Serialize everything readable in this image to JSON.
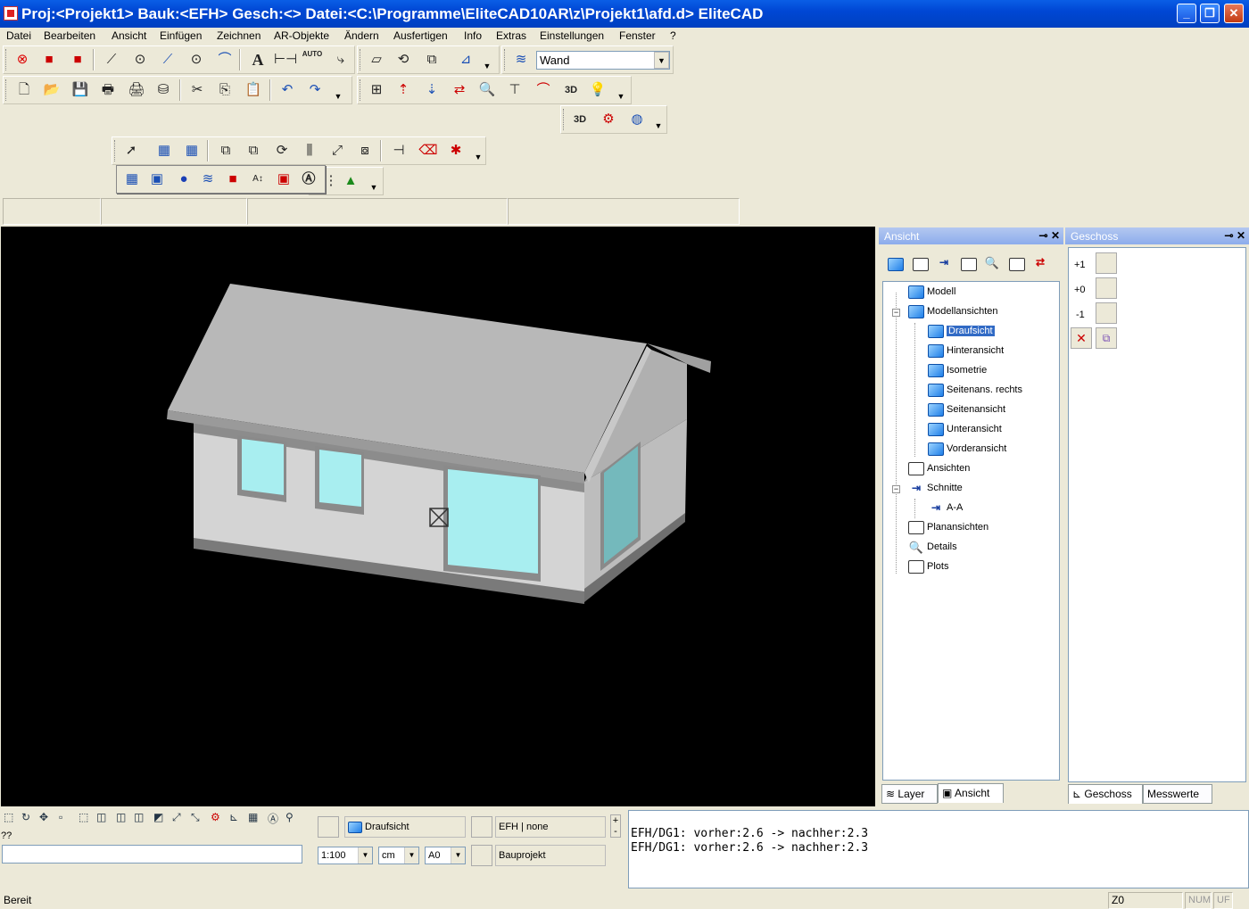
{
  "window": {
    "title": "Proj:<Projekt1> Bauk:<EFH>  Gesch:<>  Datei:<C:\\Programme\\EliteCAD10AR\\z\\Projekt1\\afd.d> EliteCAD",
    "btn_min": "_",
    "btn_max": "❐",
    "btn_close": "✕"
  },
  "menu": [
    "Datei",
    "Bearbeiten",
    "Ansicht",
    "Einfügen",
    "Zeichnen",
    "AR-Objekte",
    "Ändern",
    "Ausfertigen",
    "Info",
    "Extras",
    "Einstellungen",
    "Fenster",
    "?"
  ],
  "toolbar": {
    "layer_combo": "Wand",
    "text_tool": "A",
    "auto_tool": "AUTO"
  },
  "ansicht_panel": {
    "title": "Ansicht",
    "tree": [
      {
        "label": "Modell",
        "icon": "cube-icon"
      },
      {
        "label": "Modellansichten",
        "icon": "cube-icon"
      },
      {
        "label": "Draufsicht",
        "icon": "cube-icon",
        "selected": true
      },
      {
        "label": "Hinteransicht",
        "icon": "cube-icon"
      },
      {
        "label": "Isometrie",
        "icon": "cube-icon"
      },
      {
        "label": "Seitenans. rechts",
        "icon": "cube-icon"
      },
      {
        "label": "Seitenansicht",
        "icon": "cube-icon"
      },
      {
        "label": "Unteransicht",
        "icon": "cube-icon"
      },
      {
        "label": "Vorderansicht",
        "icon": "cube-icon"
      },
      {
        "label": "Ansichten",
        "icon": "view-icon"
      },
      {
        "label": "Schnitte",
        "icon": "section-icon"
      },
      {
        "label": "A-A",
        "icon": "section-icon"
      },
      {
        "label": "Planansichten",
        "icon": "plan-icon"
      },
      {
        "label": "Details",
        "icon": "magnifier-icon"
      },
      {
        "label": "Plots",
        "icon": "plot-icon"
      }
    ],
    "tabs": [
      "Layer",
      "Ansicht"
    ]
  },
  "geschoss_panel": {
    "title": "Geschoss",
    "floors": [
      "+1",
      "+0",
      "-1"
    ],
    "tabs": [
      "Geschoss",
      "Messwerte"
    ]
  },
  "bottom": {
    "prompt": "??",
    "view_name": "Draufsicht",
    "floor_name": "EFH | none",
    "project_name": "Bauprojekt",
    "scale": "1:100",
    "unit": "cm",
    "paper": "A0",
    "pm_plus": "+",
    "pm_minus": "-"
  },
  "console": {
    "lines": [
      "EFH/DG1: vorher:2.6 -> nachher:2.3",
      "EFH/DG1: vorher:2.6 -> nachher:2.3"
    ]
  },
  "status": {
    "text": "Bereit",
    "z": "Z0",
    "num": "NUM",
    "uf": "UF"
  },
  "colors": {
    "titlebar": "#0a5ee6",
    "viewport_bg": "#000000",
    "selection": "#316ac5",
    "window_glass": "#a8eef0"
  }
}
